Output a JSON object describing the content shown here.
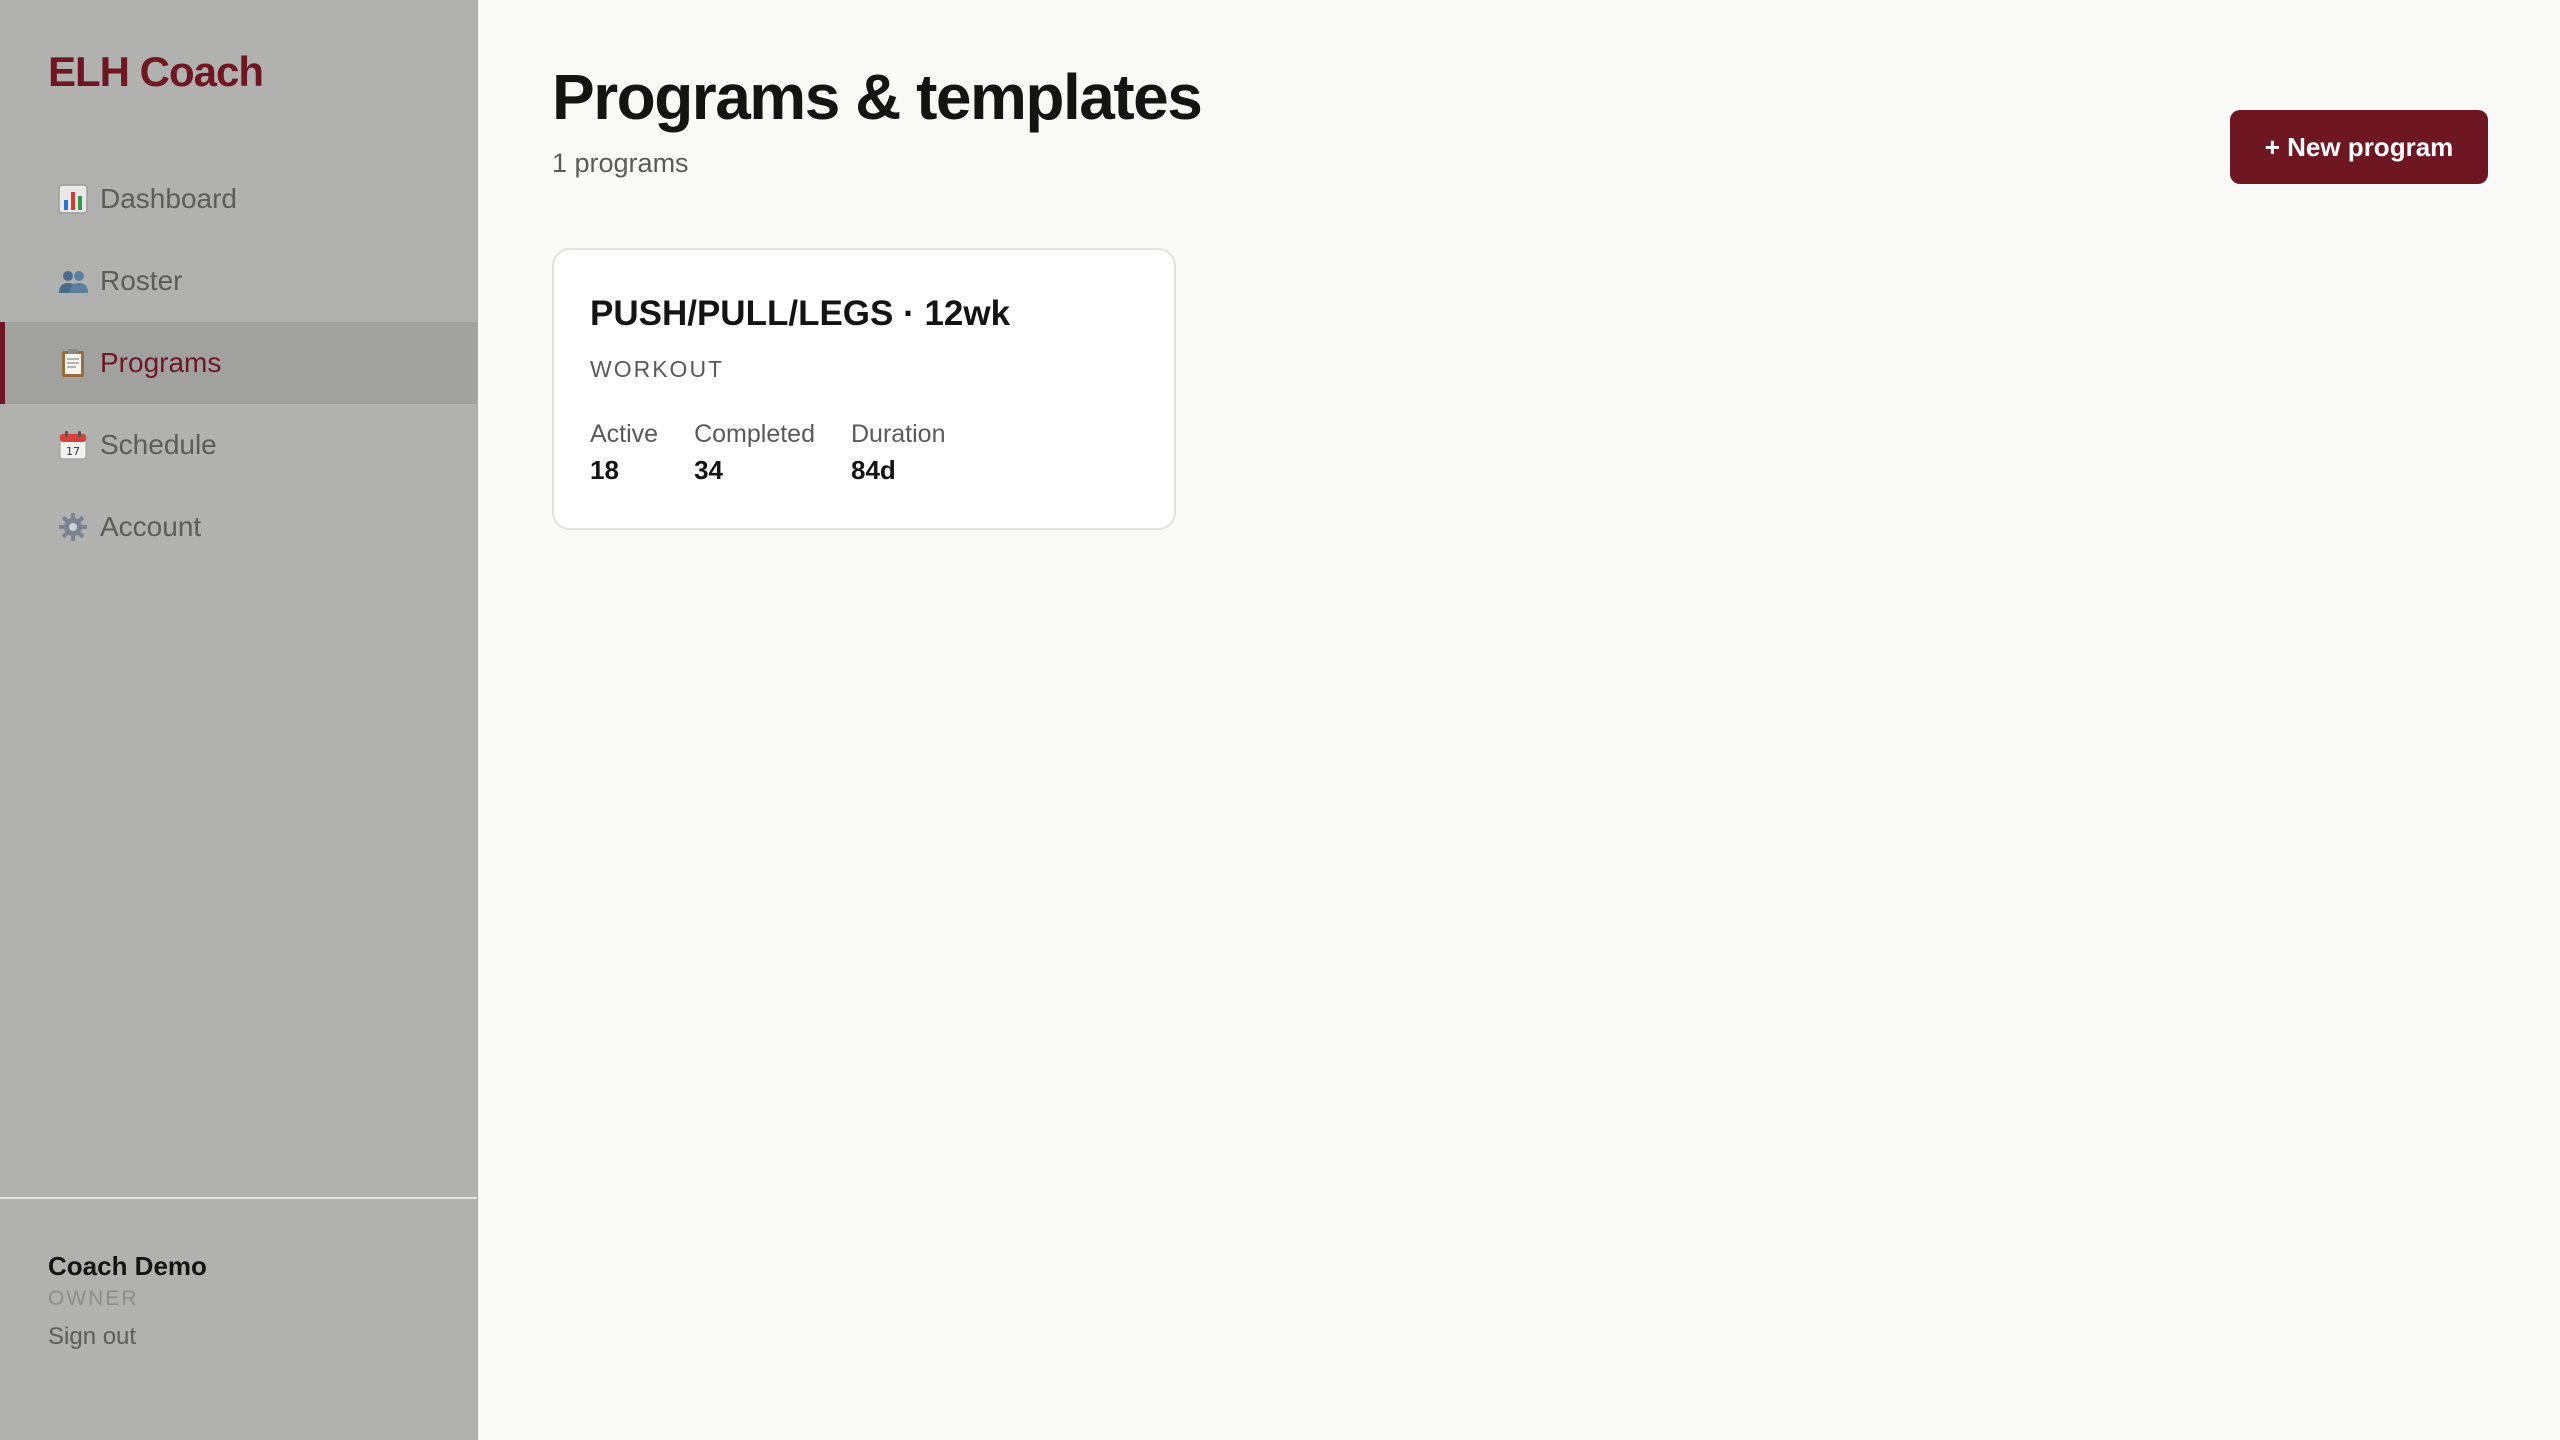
{
  "app": {
    "brand": "ELH Coach"
  },
  "sidebar": {
    "items": [
      {
        "label": "Dashboard",
        "icon": "bar-chart-icon",
        "active": false
      },
      {
        "label": "Roster",
        "icon": "users-icon",
        "active": false
      },
      {
        "label": "Programs",
        "icon": "clipboard-icon",
        "active": true
      },
      {
        "label": "Schedule",
        "icon": "calendar-icon",
        "active": false
      },
      {
        "label": "Account",
        "icon": "gear-icon",
        "active": false
      }
    ],
    "user": {
      "name": "Coach Demo",
      "role": "OWNER",
      "sign_out": "Sign out"
    }
  },
  "main": {
    "title": "Programs & templates",
    "subtitle": "1 programs",
    "new_button": "+ New program",
    "programs": [
      {
        "title": "PUSH/PULL/LEGS · 12wk",
        "type": "WORKOUT",
        "stats": [
          {
            "label": "Active",
            "value": "18"
          },
          {
            "label": "Completed",
            "value": "34"
          },
          {
            "label": "Duration",
            "value": "84d"
          }
        ]
      }
    ]
  },
  "colors": {
    "accent": "#6e1723",
    "sidebar_bg": "#b1b1af",
    "sidebar_active_bg": "#a1a19f",
    "page_bg": "#f9f9f7",
    "card_bg": "#ffffff"
  }
}
